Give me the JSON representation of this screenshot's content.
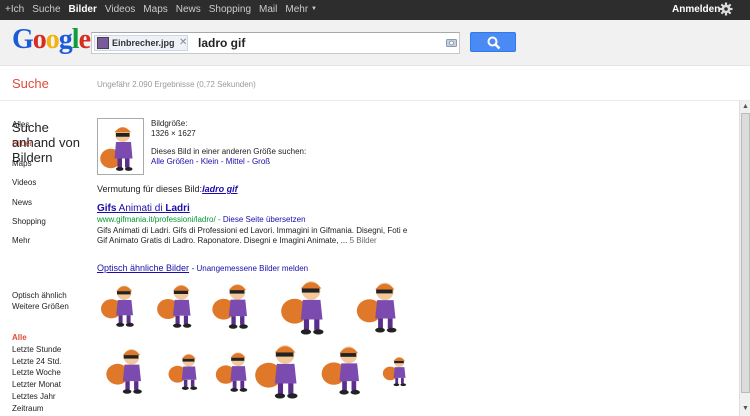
{
  "topbar": {
    "items": [
      "+Ich",
      "Suche",
      "Bilder",
      "Videos",
      "Maps",
      "News",
      "Shopping",
      "Mail",
      "Mehr"
    ],
    "active_index": 2,
    "signin": "Anmelden"
  },
  "search": {
    "chip_filename": "Einbrecher.jpg",
    "query": "ladro gif"
  },
  "page": {
    "title": "Suche",
    "result_count": "Ungefähr 2.090 Ergebnisse (0,72 Sekunden)"
  },
  "leftnav": {
    "items": [
      "Alles",
      "Bilder",
      "Maps",
      "Videos",
      "News",
      "Shopping",
      "Mehr"
    ],
    "active_index": 1,
    "section_title": "Suche anhand von Bildern",
    "section_items": [
      "Optisch ähnlich",
      "Weitere Größen"
    ],
    "time_header": "Alle",
    "time_items": [
      "Letzte Stunde",
      "Letzte 24 Std.",
      "Letzte Woche",
      "Letzter Monat",
      "Letztes Jahr",
      "Zeitraum"
    ]
  },
  "image_info": {
    "size_label": "Bildgröße:",
    "size_value": "1326 × 1627",
    "other_sizes_label": "Dieses Bild in einer anderen Größe suchen:",
    "size_links": [
      "Alle Größen",
      "Klein",
      "Mittel",
      "Groß"
    ]
  },
  "guess": {
    "label": "Vermutung für dieses Bild:",
    "term": "ladro gif"
  },
  "result": {
    "title_parts": [
      "Gifs",
      " Animati di ",
      "Ladri"
    ],
    "url": "www.gifmania.it/professioni/ladro/",
    "translate": "Diese Seite übersetzen",
    "snippet_line1": "Gifs Animati di Ladri. Gifs di Professioni ed Lavori. Immagini in Gifmania. Disegni, Foti e",
    "snippet_line2": "Gif Animato Gratis di Ladro. Raponatore. Disegni e Imagini Animate, ...",
    "more": "5 Bilder"
  },
  "similar": {
    "title": "Optisch ähnliche Bilder",
    "report": "Unangemessene Bilder melden"
  },
  "colors": {
    "accent_red": "#dd4b39",
    "link_blue": "#1a0dab",
    "url_green": "#009933",
    "button_blue": "#4a8af4"
  }
}
